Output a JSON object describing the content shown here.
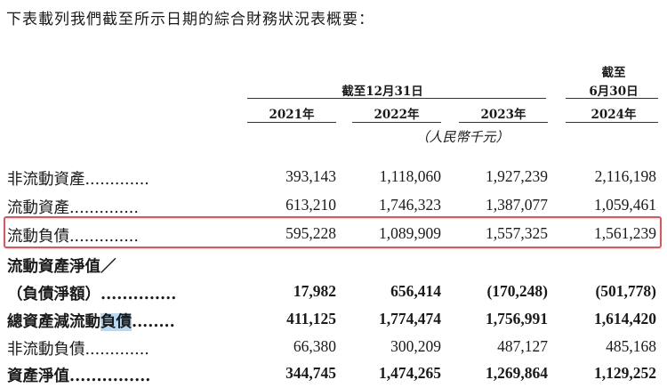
{
  "intro": "下表載列我們截至所示日期的綜合財務狀況表概要：",
  "headers": {
    "group_top": "截至12月31日",
    "right_top1": "截至",
    "right_top2": "6月30日",
    "years": [
      "2021年",
      "2022年",
      "2023年",
      "2024年"
    ],
    "unit": "（人民幣千元）"
  },
  "rows": [
    {
      "label": "非流動資產.............",
      "values": [
        "393,143",
        "1,118,060",
        "1,927,239",
        "2,116,198"
      ],
      "bold": false
    },
    {
      "label": "流動資產..............",
      "values": [
        "613,210",
        "1,746,323",
        "1,387,077",
        "1,059,461"
      ],
      "bold": false
    },
    {
      "label": "流動負債..............",
      "values": [
        "595,228",
        "1,089,909",
        "1,557,325",
        "1,561,239"
      ],
      "bold": false,
      "highlighted": true
    },
    {
      "label": "流動資產淨值／",
      "values": [
        "",
        "",
        "",
        ""
      ],
      "bold": true
    },
    {
      "label": "（負債淨額）..............",
      "values": [
        "17,982",
        "656,414",
        "(170,248)",
        "(501,778)"
      ],
      "bold": true
    },
    {
      "label_pre": "總資產減流動",
      "label_sel": "負債",
      "label_post": "........",
      "values": [
        "411,125",
        "1,774,474",
        "1,756,991",
        "1,614,420"
      ],
      "bold": true
    },
    {
      "label": "非流動負債.............",
      "values": [
        "66,380",
        "300,209",
        "487,127",
        "485,168"
      ],
      "bold": false
    },
    {
      "label": "資產淨值...............",
      "values": [
        "344,745",
        "1,474,265",
        "1,269,864",
        "1,129,252"
      ],
      "bold": true
    }
  ]
}
